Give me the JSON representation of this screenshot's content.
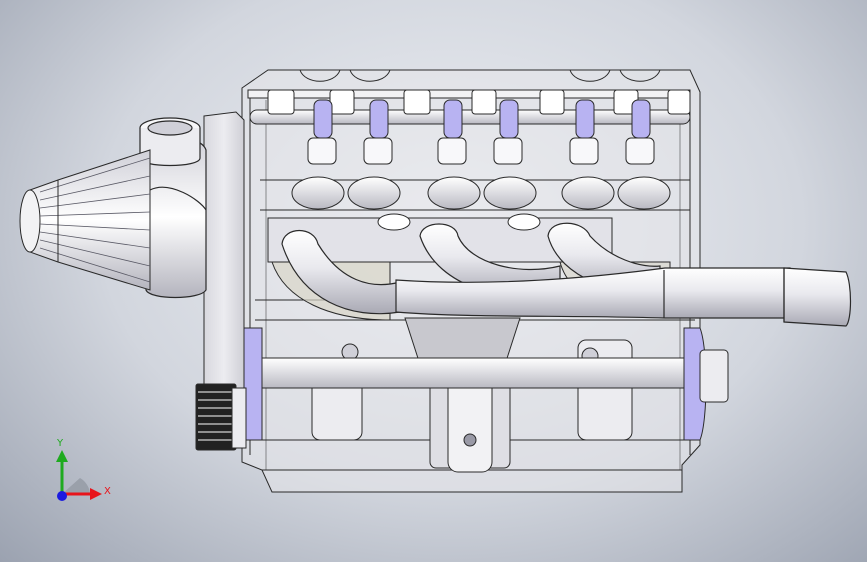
{
  "viewport": {
    "background_top": "#eef0f4",
    "background_edge": "#9ba2b0"
  },
  "model": {
    "line_color": "#2a2a2a",
    "body_fill": "#e8e8ec",
    "accent_fill": "#b8b3f2",
    "metal_fill": "#f4f4f6"
  },
  "triad": {
    "x_label": "X",
    "y_label": "Y",
    "x_color": "#e8141b",
    "y_color": "#1faa1f",
    "z_color": "#1a1ae0"
  }
}
